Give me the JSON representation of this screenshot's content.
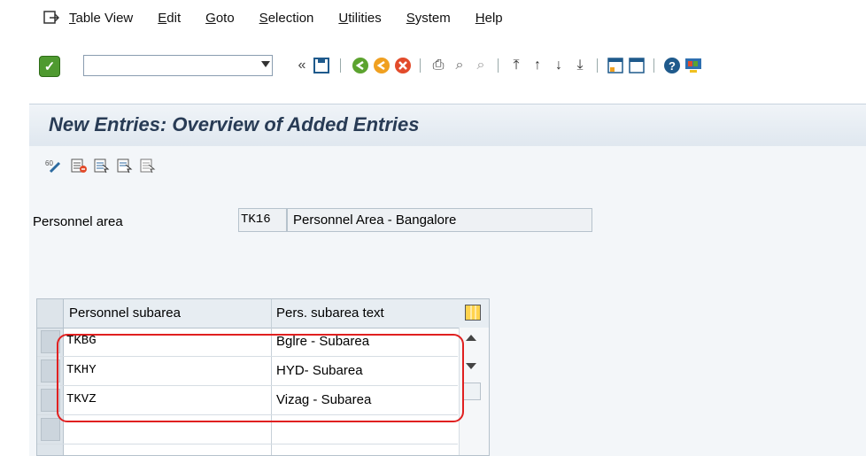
{
  "menubar": {
    "icon": "exit-menu-icon",
    "items": [
      "Table View",
      "Edit",
      "Goto",
      "Selection",
      "Utilities",
      "System",
      "Help"
    ]
  },
  "toolbar": {
    "command_field_value": "",
    "icons": [
      "enter-icon",
      "command-dropdown-icon",
      "collapse-icon",
      "save-icon",
      "back-icon",
      "exit-icon",
      "cancel-icon",
      "print-icon",
      "find-icon",
      "find-next-icon",
      "first-page-icon",
      "previous-page-icon",
      "next-page-icon",
      "last-page-icon",
      "create-session-icon",
      "shortcut-icon",
      "help-icon",
      "customize-layout-icon"
    ]
  },
  "title": "New Entries: Overview of Added Entries",
  "application_toolbar": {
    "icons": [
      "change-display-icon",
      "delete-icon",
      "select-all-icon",
      "select-block-icon",
      "deselect-all-icon"
    ]
  },
  "header": {
    "personnel_area_label": "Personnel area",
    "personnel_area_code": "TK16",
    "personnel_area_text": "Personnel Area - Bangalore"
  },
  "table": {
    "columns": [
      "Personnel subarea",
      "Pers. subarea text"
    ],
    "rows": [
      {
        "subarea": "TKBG",
        "text": "Bglre - Subarea"
      },
      {
        "subarea": "TKHY",
        "text": "HYD- Subarea"
      },
      {
        "subarea": "TKVZ",
        "text": "Vizag - Subarea"
      },
      {
        "subarea": "",
        "text": ""
      }
    ]
  },
  "colors": {
    "title": "#283b55",
    "highlight": "#e02020",
    "enter_button": "#4f9a30"
  }
}
